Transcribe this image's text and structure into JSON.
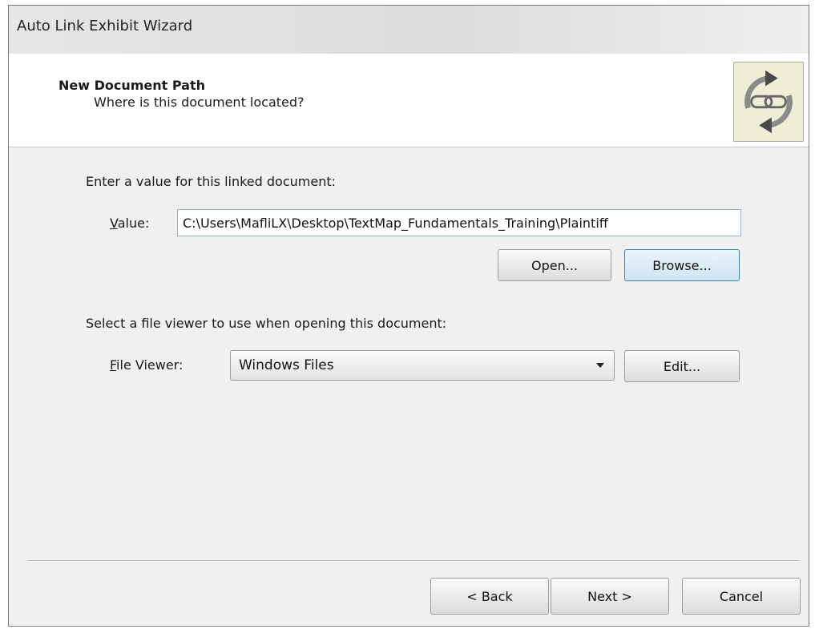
{
  "window": {
    "title": "Auto Link Exhibit Wizard"
  },
  "header": {
    "title": "New Document Path",
    "subtitle": "Where is this document located?",
    "logo_icon": "link-chain-refresh-icon"
  },
  "value_section": {
    "prompt": "Enter a value for this linked document:",
    "label_mnemonic": "V",
    "label_rest": "alue:",
    "value": "C:\\Users\\MafliLX\\Desktop\\TextMap_Fundamentals_Training\\Plaintiff",
    "open_label": "Open...",
    "browse_label": "Browse..."
  },
  "viewer_section": {
    "prompt": "Select a file viewer to use when opening this document:",
    "label_mnemonic": "F",
    "label_rest": "ile Viewer:",
    "selected": "Windows Files",
    "edit_label": "Edit..."
  },
  "footer": {
    "back_label": "< Back",
    "next_label": "Next >",
    "cancel_label": "Cancel"
  },
  "colors": {
    "focus_border": "#3c7fb1",
    "logo_bg": "#eeeed6",
    "arrow_gray": "#8a8a8a"
  }
}
